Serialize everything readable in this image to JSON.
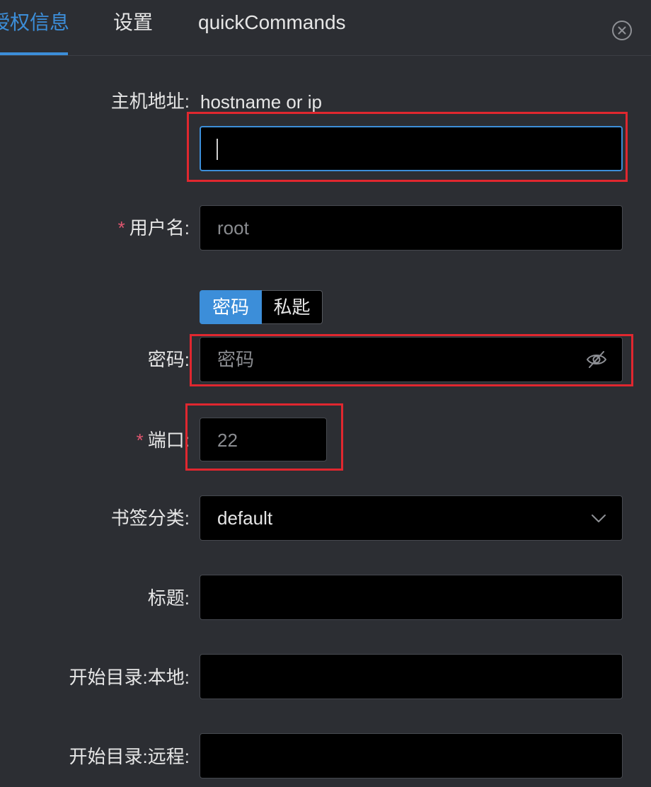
{
  "tabs": {
    "auth": "授权信息",
    "settings": "设置",
    "quick": "quickCommands"
  },
  "form": {
    "host_label": "主机地址:",
    "host_hint": "hostname or ip",
    "host_value": "",
    "username_label": "用户名:",
    "username_placeholder": "root",
    "auth_type_password": "密码",
    "auth_type_key": "私匙",
    "password_label": "密码:",
    "password_placeholder": "密码",
    "port_label": "端口:",
    "port_placeholder": "22",
    "category_label": "书签分类:",
    "category_value": "default",
    "title_label": "标题:",
    "title_value": "",
    "local_dir_label": "开始目录:本地:",
    "local_dir_value": "",
    "remote_dir_label": "开始目录:远程:",
    "remote_dir_value": "",
    "required_mark": "*"
  },
  "colors": {
    "accent": "#3c8ed9",
    "background": "#2c2e33",
    "input_bg": "#000000",
    "highlight_box": "#e0272f",
    "required": "#e0566f"
  },
  "icons": {
    "close": "close-circle-icon",
    "password_visibility": "eye-invisible-icon",
    "dropdown": "chevron-down-icon"
  }
}
